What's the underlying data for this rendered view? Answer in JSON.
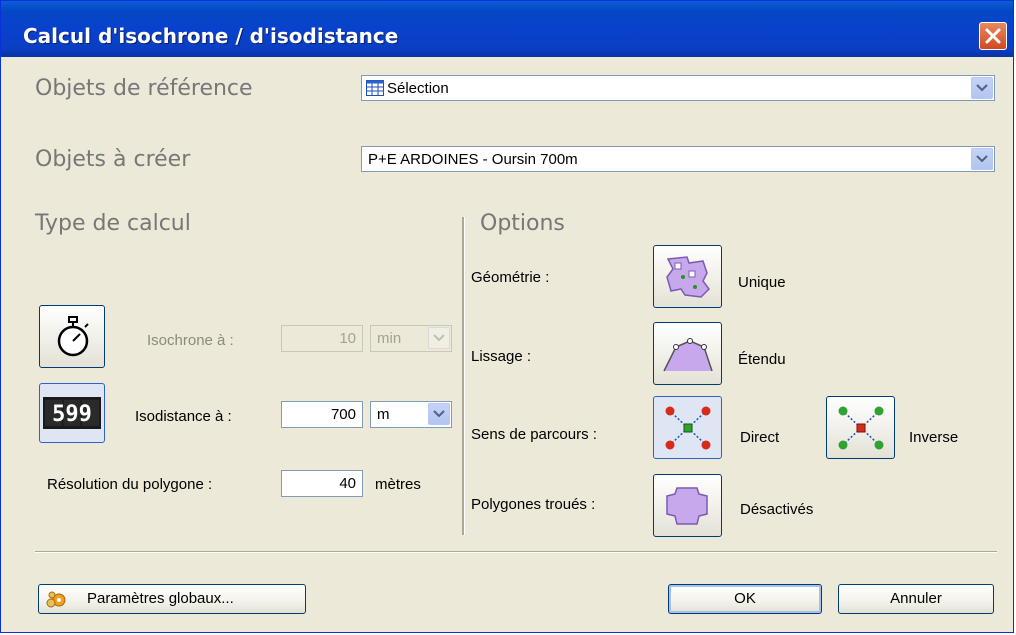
{
  "window": {
    "title": "Calcul d'isochrone / d'isodistance"
  },
  "reference": {
    "label": "Objets de référence",
    "value": "Sélection",
    "icon": "table-icon"
  },
  "create": {
    "label": "Objets à créer",
    "value": "P+E ARDOINES - Oursin 700m"
  },
  "calc_type": {
    "heading": "Type de calcul",
    "isochrone": {
      "label": "Isochrone à :",
      "value": "10",
      "unit": "min",
      "icon": "stopwatch-icon"
    },
    "isodistance": {
      "label": "Isodistance à :",
      "value": "700",
      "unit": "m",
      "icon": "counter-599-icon",
      "counter_text": "599"
    },
    "resolution": {
      "label": "Résolution du polygone :",
      "value": "40",
      "unit": "mètres"
    }
  },
  "options": {
    "heading": "Options",
    "geometry": {
      "label": "Géométrie :",
      "value": "Unique"
    },
    "smoothing": {
      "label": "Lissage :",
      "value": "Étendu"
    },
    "direction": {
      "label": "Sens de parcours :",
      "direct": "Direct",
      "inverse": "Inverse"
    },
    "holes": {
      "label": "Polygones troués :",
      "value": "Désactivés"
    }
  },
  "footer": {
    "global_params": "Paramètres globaux...",
    "ok": "OK",
    "cancel": "Annuler"
  },
  "colors": {
    "titlebar": "#0a3fc2",
    "dialog_bg": "#ece9d8",
    "icon_fill": "#c8a8ec",
    "close": "#d04920"
  }
}
